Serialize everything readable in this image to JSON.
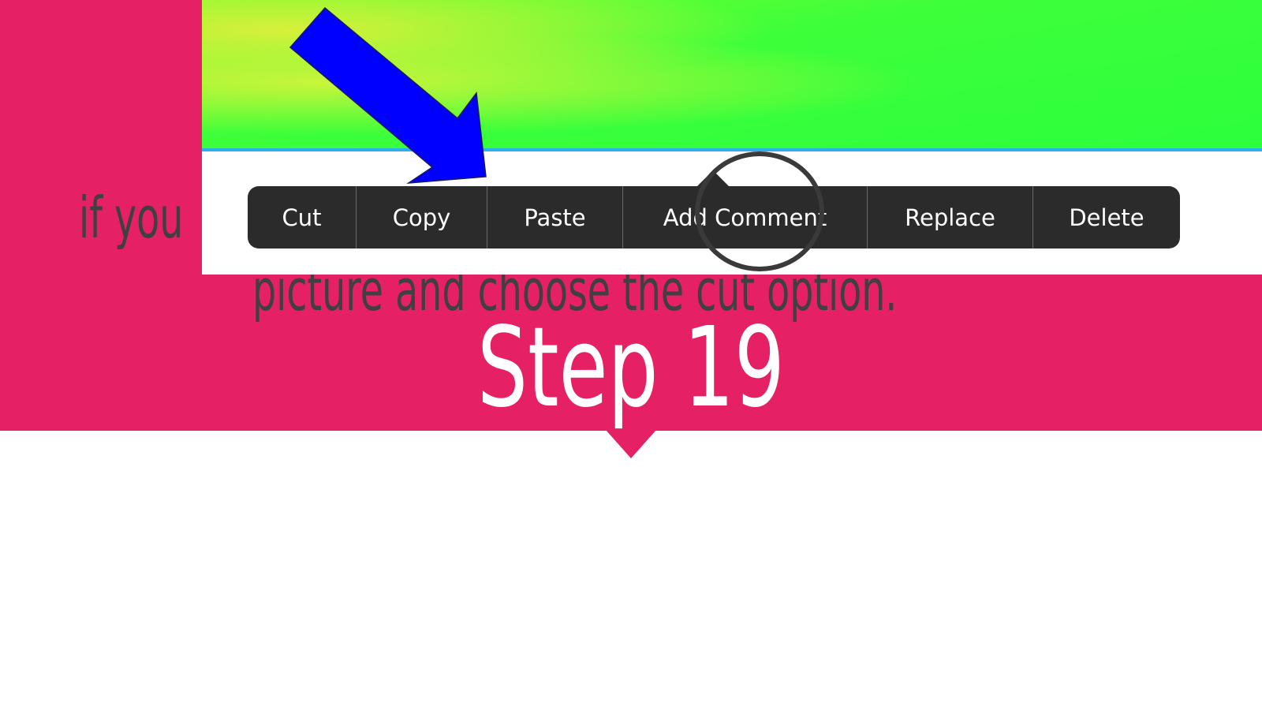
{
  "step": {
    "title": "Step 19"
  },
  "instruction": {
    "line1": "if you",
    "line2": "picture and choose the cut option."
  },
  "context_menu": {
    "items": [
      {
        "label": "Cut"
      },
      {
        "label": "Copy"
      },
      {
        "label": "Paste"
      },
      {
        "label": "Add Comment"
      },
      {
        "label": "Replace"
      },
      {
        "label": "Delete"
      }
    ],
    "highlighted": "Paste"
  },
  "colors": {
    "background_band": "#e62064",
    "menu_background": "#2b2b2b",
    "arrow": "#0000ff",
    "image_green": "#2cff3d",
    "image_border": "#2ab0ef"
  },
  "icons": [
    "arrow-icon",
    "highlight-circle"
  ]
}
